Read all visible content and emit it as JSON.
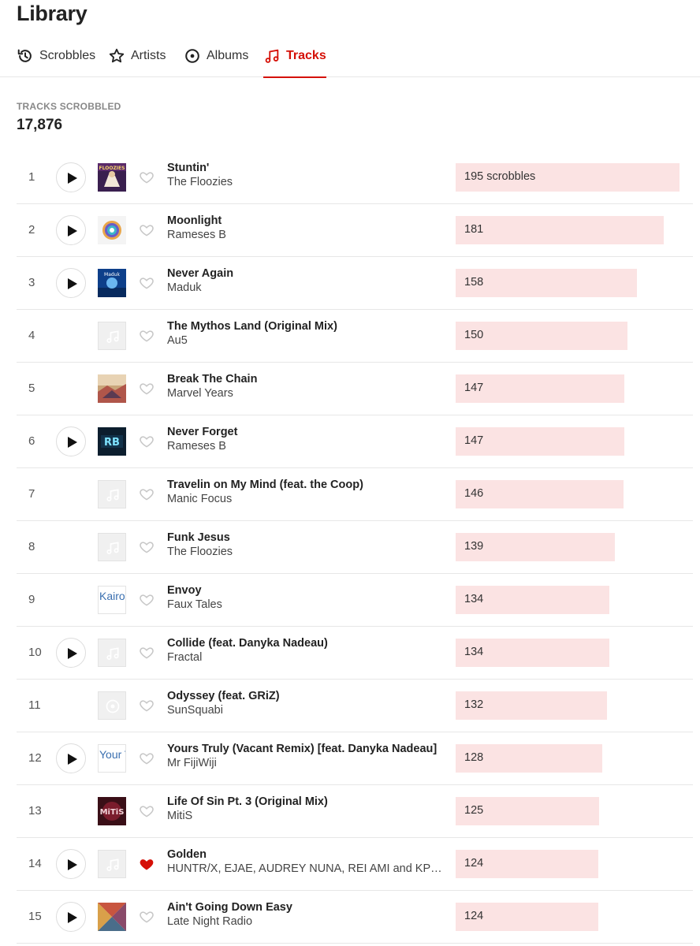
{
  "header": {
    "title": "Library"
  },
  "tabs": [
    {
      "label": "Scrobbles",
      "icon": "history-icon",
      "active": false
    },
    {
      "label": "Artists",
      "icon": "star-icon",
      "active": false
    },
    {
      "label": "Albums",
      "icon": "disc-icon",
      "active": false
    },
    {
      "label": "Tracks",
      "icon": "music-note-icon",
      "active": true
    }
  ],
  "stats": {
    "label": "TRACKS SCROBBLED",
    "value": "17,876"
  },
  "colors": {
    "accent": "#d51007",
    "bar": "#fbe3e3",
    "loved": "#d51007"
  },
  "tracks": [
    {
      "rank": "1",
      "title": "Stuntin'",
      "artist": "The Floozies",
      "count_label": "195 scrobbles",
      "count": 195,
      "playable": true,
      "loved": false,
      "art": "floozies-art"
    },
    {
      "rank": "2",
      "title": "Moonlight",
      "artist": "Rameses B",
      "count_label": "181",
      "count": 181,
      "playable": true,
      "loved": false,
      "art": "moonlight-art"
    },
    {
      "rank": "3",
      "title": "Never Again",
      "artist": "Maduk",
      "count_label": "158",
      "count": 158,
      "playable": true,
      "loved": false,
      "art": "maduk-art"
    },
    {
      "rank": "4",
      "title": "The Mythos Land (Original Mix)",
      "artist": "Au5",
      "count_label": "150",
      "count": 150,
      "playable": false,
      "loved": false,
      "art": "placeholder"
    },
    {
      "rank": "5",
      "title": "Break The Chain",
      "artist": "Marvel Years",
      "count_label": "147",
      "count": 147,
      "playable": false,
      "loved": false,
      "art": "marvel-art"
    },
    {
      "rank": "6",
      "title": "Never Forget",
      "artist": "Rameses B",
      "count_label": "147",
      "count": 147,
      "playable": true,
      "loved": false,
      "art": "rb-art"
    },
    {
      "rank": "7",
      "title": "Travelin on My Mind (feat. the Coop)",
      "artist": "Manic Focus",
      "count_label": "146",
      "count": 146,
      "playable": false,
      "loved": false,
      "art": "placeholder"
    },
    {
      "rank": "8",
      "title": "Funk Jesus",
      "artist": "The Floozies",
      "count_label": "139",
      "count": 139,
      "playable": false,
      "loved": false,
      "art": "placeholder"
    },
    {
      "rank": "9",
      "title": "Envoy",
      "artist": "Faux Tales",
      "count_label": "134",
      "count": 134,
      "playable": false,
      "loved": false,
      "art": "text",
      "art_text": "Kairo"
    },
    {
      "rank": "10",
      "title": "Collide (feat. Danyka Nadeau)",
      "artist": "Fractal",
      "count_label": "134",
      "count": 134,
      "playable": true,
      "loved": false,
      "art": "placeholder"
    },
    {
      "rank": "11",
      "title": "Odyssey (feat. GRiZ)",
      "artist": "SunSquabi",
      "count_label": "132",
      "count": 132,
      "playable": false,
      "loved": false,
      "art": "disc-placeholder"
    },
    {
      "rank": "12",
      "title": "Yours Truly (Vacant Remix) [feat. Danyka Nadeau]",
      "artist": "Mr FijiWiji",
      "count_label": "128",
      "count": 128,
      "playable": true,
      "loved": false,
      "art": "text",
      "art_text": "Your Trul"
    },
    {
      "rank": "13",
      "title": "Life Of Sin Pt. 3 (Original Mix)",
      "artist": "MitiS",
      "count_label": "125",
      "count": 125,
      "playable": false,
      "loved": false,
      "art": "mitis-art"
    },
    {
      "rank": "14",
      "title": "Golden",
      "artist": "HUNTR/X, EJAE, AUDREY NUNA, REI AMI and KPo…",
      "count_label": "124",
      "count": 124,
      "playable": true,
      "loved": true,
      "art": "placeholder"
    },
    {
      "rank": "15",
      "title": "Ain't Going Down Easy",
      "artist": "Late Night Radio",
      "count_label": "124",
      "count": 124,
      "playable": true,
      "loved": false,
      "art": "lnr-art"
    }
  ]
}
